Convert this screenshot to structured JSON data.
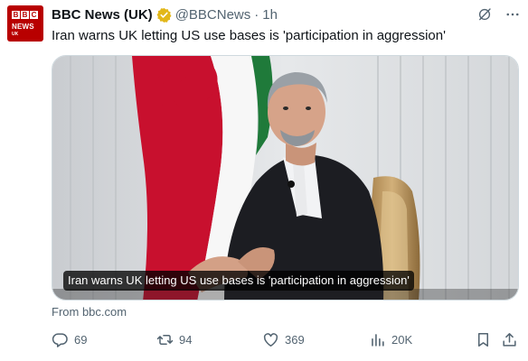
{
  "tweet": {
    "avatar": {
      "blocks": [
        "B",
        "B",
        "C"
      ],
      "line1": "NEWS",
      "line2": "UK"
    },
    "author": {
      "display_name": "BBC News (UK)",
      "handle": "@BBCNews",
      "separator": "·",
      "time": "1h",
      "verified_color": "#e2b719"
    },
    "text": "Iran warns UK letting US use bases is 'participation in aggression'",
    "media": {
      "caption": "Iran warns UK letting US use bases is 'participation in aggression'",
      "source": "From bbc.com"
    },
    "actions": {
      "replies": "69",
      "reposts": "94",
      "likes": "369",
      "views": "20K"
    }
  },
  "icons": {
    "header": [
      "grok-icon",
      "more-icon"
    ],
    "actions": [
      "reply-icon",
      "repost-icon",
      "like-icon",
      "views-icon",
      "bookmark-icon",
      "share-icon"
    ]
  },
  "colors": {
    "text_primary": "#0f1419",
    "text_secondary": "#536471",
    "bbc_red": "#b80000",
    "border": "#cfd9de"
  }
}
